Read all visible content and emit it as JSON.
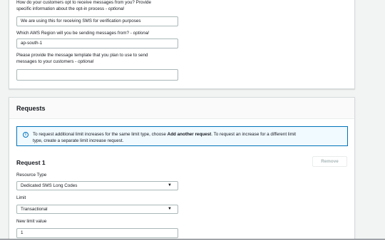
{
  "optin": {
    "question_line1": "How do your customers opt to receive messages from you? Provide",
    "question_line2_prefix": "specific information about the opt-in process - ",
    "question_optional": "optional",
    "value": "We are using this for receiving SMS for verification purposes"
  },
  "region": {
    "question_prefix": "Which AWS Region will you be sending messages from? - ",
    "question_optional": "optional",
    "value": "ap-south-1"
  },
  "template": {
    "question_line1": "Please provide the message template that you plan to use to send",
    "question_line2_prefix": "messages to your customers - ",
    "question_optional": "optional",
    "value": ""
  },
  "requests": {
    "title": "Requests",
    "info_part1": "To request additional limit increases for the same limit type, choose ",
    "info_bold": "Add another request",
    "info_part2": ". To request an increase for a different limit",
    "info_line2": "type, create a separate limit increase request.",
    "request_title": "Request 1",
    "remove_label": "Remove",
    "resource_type_label": "Resource Type",
    "resource_type_value": "Dedicated SMS Long Codes",
    "limit_label": "Limit",
    "limit_value": "Transactional",
    "new_limit_label": "New limit value",
    "new_limit_value": "1"
  },
  "icons": {
    "info": "info-icon",
    "caret": "caret-down-icon"
  }
}
